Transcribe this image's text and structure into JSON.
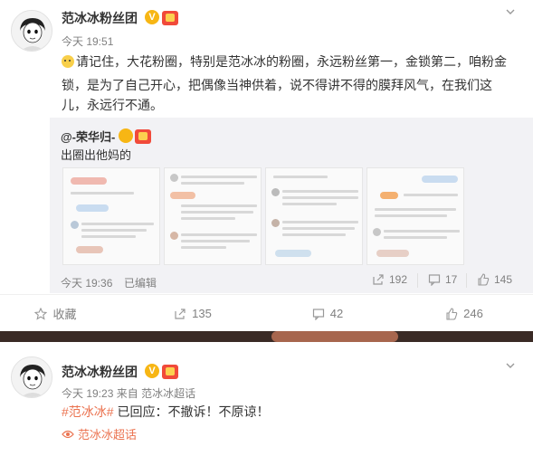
{
  "post1": {
    "author": "范冰冰粉丝团",
    "time": "今天 19:51",
    "text_lines": [
      "请记住，大花粉圈，特别是范冰冰的粉圈，永远粉丝第一，金锁第二，咱粉金",
      "锁，是为了自己开心，把偶像当神供着，说不得讲不得的膜拜风气，在我们这",
      "儿，永远行不通。"
    ],
    "emoji_icon": "doge-emoji-icon",
    "repost": {
      "author": "@-荣华归-",
      "text": "出圈出他妈的",
      "time": "今天 19:36",
      "edited": "已编辑",
      "reposts": "192",
      "comments": "17",
      "likes": "145"
    },
    "actions": {
      "favorite": "收藏",
      "repost": "135",
      "comment": "42",
      "like": "246"
    }
  },
  "post2": {
    "author": "范冰冰粉丝团",
    "time": "今天 19:23",
    "source_prefix": "来自",
    "source": "范冰冰超话",
    "hashtag": "#范冰冰#",
    "text": " 已回应：不撤诉！不原谅！",
    "link": "范冰冰超话"
  },
  "colors": {
    "accent": "#eb7350",
    "muted": "#808080",
    "repost_bg": "#f2f2f5",
    "vip_badge": "#f7b614"
  }
}
